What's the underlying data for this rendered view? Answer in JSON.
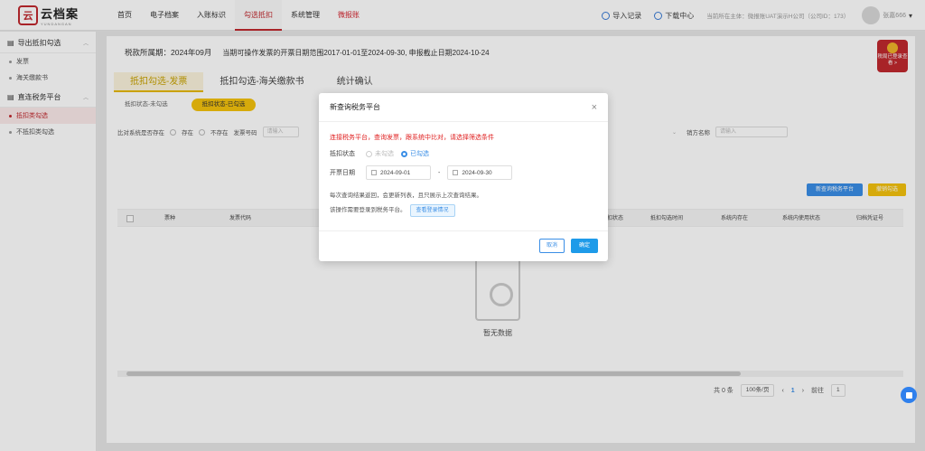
{
  "logo": {
    "name": "云档案",
    "sub": "YUNDANGAN",
    "mark": "云"
  },
  "nav": [
    "首页",
    "电子档案",
    "入账标识",
    "勾选抵扣",
    "系统管理",
    "微报账"
  ],
  "top_right": {
    "import": "导入记录",
    "download": "下载中心",
    "env": "当前所在主体：微报账UAT演示H公司（公司ID：173）",
    "user": "张嘉666"
  },
  "sidebar": {
    "group1": "导出抵扣勾选",
    "group1_items": [
      "发票",
      "海关缴款书"
    ],
    "group2": "直连税务平台",
    "group2_items": [
      "抵扣类勾选",
      "不抵扣类勾选"
    ]
  },
  "page": {
    "period_label": "税款所属期：2024年09月",
    "period_range": "当期可操作发票的开票日期范围2017-01-01至2024-09-30, 申报截止日期2024-10-24",
    "badge": "税局已登录查看 >",
    "tabs": [
      "抵扣勾选-发票",
      "抵扣勾选-海关缴款书",
      "统计确认"
    ],
    "subtabs": [
      "抵扣状态-未勾选",
      "抵扣状态-已勾选"
    ]
  },
  "filter": {
    "label1": "比对系统是否存在",
    "opt1": "存在",
    "opt2": "不存在",
    "label2": "发票号码",
    "placeholder": "请输入",
    "label3": "销方名称",
    "placeholder2": "请输入"
  },
  "actions": {
    "refresh": "新查询税务平台",
    "unselect": "撤销勾选"
  },
  "table": {
    "headers": [
      "票种",
      "发票代码",
      "抵扣状态",
      "抵扣勾选时间",
      "系统内存在",
      "系统内使用状态",
      "归档凭证号"
    ],
    "empty": "暂无数据"
  },
  "pager": {
    "total": "共 0 条",
    "size": "100条/页",
    "prev": "‹",
    "page": "1",
    "next": "›",
    "goto": "前往",
    "goto_val": "1"
  },
  "modal": {
    "title": "新查询税务平台",
    "close": "×",
    "warning": "连接税务平台，查询发票，跟系统中比对，请选择筛选条件",
    "state_label": "抵扣状态",
    "state_opt1": "未勾选",
    "state_opt2": "已勾选",
    "date_label": "开票日期",
    "date_from": "2024-09-01",
    "date_sep": "-",
    "date_to": "2024-09-30",
    "note1": "每次查询结果返回，会更新列表，且只展示上次查询结果。",
    "note2": "该操作需要登录到税务平台。",
    "login_btn": "查看登录情况",
    "cancel": "取消",
    "ok": "确定"
  }
}
